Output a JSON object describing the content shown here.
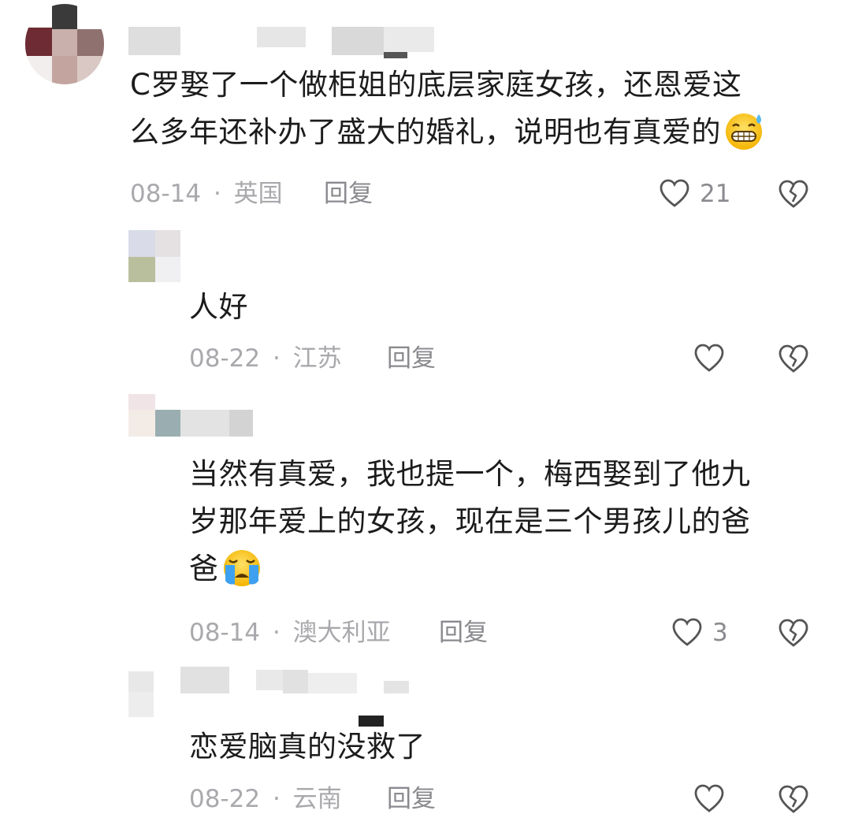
{
  "comments": [
    {
      "text_lines": [
        "C罗娶了一个做柜姐的底层家庭女孩，还恩爱这",
        "么多年还补办了盛大的婚礼，说明也有真爱的"
      ],
      "emoji": "grinning-sweat-emoji",
      "date": "08-14",
      "location": "英国",
      "reply_label": "回复",
      "likes": "21"
    },
    {
      "text_lines": [
        "人好"
      ],
      "date": "08-22",
      "location": "江苏",
      "reply_label": "回复",
      "likes": ""
    },
    {
      "text_lines": [
        "当然有真爱，我也提一个，梅西娶到了他九",
        "岁那年爱上的女孩，现在是三个男孩儿的爸",
        "爸"
      ],
      "emoji": "crying-emoji",
      "date": "08-14",
      "location": "澳大利亚",
      "reply_label": "回复",
      "likes": "3"
    },
    {
      "text_lines": [
        "恋爱脑真的没救了"
      ],
      "date": "08-22",
      "location": "云南",
      "reply_label": "回复",
      "likes": ""
    }
  ],
  "separator": "·",
  "colors": {
    "text": "#1c1c1c",
    "meta": "#a9a9ad",
    "action": "#8a8a8f"
  }
}
